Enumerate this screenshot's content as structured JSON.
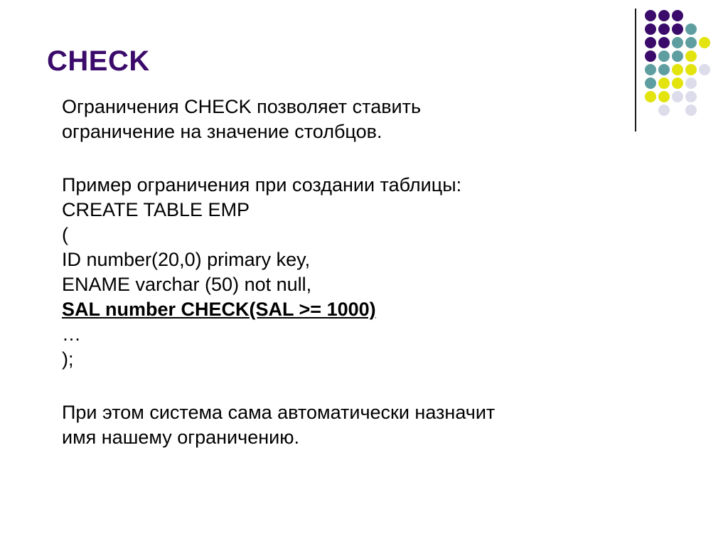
{
  "slide": {
    "title": "CHECK",
    "background_color": "#ffffff",
    "title_color": "#3B0B6B",
    "body_color": "#000000"
  },
  "body": {
    "intro": {
      "line1": "Ограничения CHECK позволяет ставить",
      "line2": "ограничение на значение столбцов."
    },
    "example": {
      "lead": "Пример ограничения при создании таблицы:",
      "code": {
        "line1": "CREATE TABLE EMP",
        "line2": "(",
        "line3": "ID number(20,0) primary key,",
        "line4": "ENAME varchar (50) not null,",
        "line5": "SAL number CHECK(SAL >= 1000)",
        "line6": "…",
        "line7": ");"
      }
    },
    "outro": {
      "line1": "При этом система сама автоматически назначит",
      "line2": "имя нашему ограничению."
    }
  },
  "decoration": {
    "name": "dot-grid-graphic",
    "colors": {
      "purple": "#3B0B6B",
      "teal": "#5F9EA0",
      "yellow": "#E3E30D",
      "lavender": "#DCDCEB",
      "rule": "#1a1a1a"
    },
    "rows": [
      [
        "purple",
        "purple",
        "purple"
      ],
      [
        "purple",
        "purple",
        "purple",
        "teal"
      ],
      [
        "purple",
        "purple",
        "teal",
        "teal",
        "yellow"
      ],
      [
        "purple",
        "teal",
        "teal",
        "yellow"
      ],
      [
        "teal",
        "teal",
        "yellow",
        "yellow",
        "lavender"
      ],
      [
        "teal",
        "yellow",
        "yellow",
        "lavender"
      ],
      [
        "yellow",
        "yellow",
        "lavender",
        "lavender"
      ],
      [
        "blank",
        "lavender",
        "blank",
        "lavender"
      ]
    ]
  }
}
